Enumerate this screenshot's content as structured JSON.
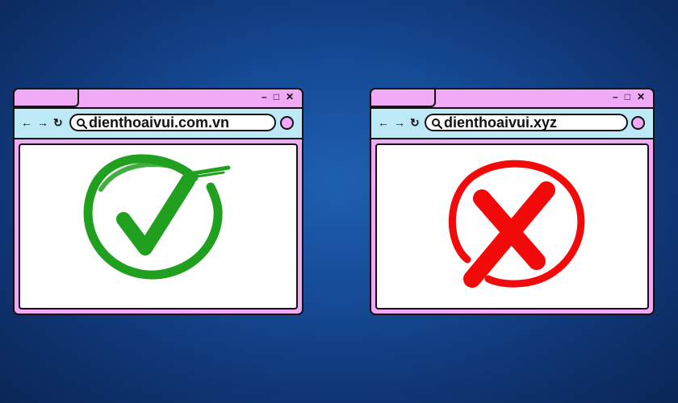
{
  "colors": {
    "background": "#164c98",
    "window_frame": "#efa9f5",
    "toolbar": "#bde8f6",
    "valid_mark": "#21a020",
    "invalid_mark": "#f20a0a"
  },
  "window_controls": {
    "minimize": "–",
    "maximize": "□",
    "close": "✕"
  },
  "nav_icons": {
    "back": "←",
    "forward": "→",
    "reload": "↻"
  },
  "browsers": [
    {
      "url": "dienthoaivui.com.vn",
      "status_icon": "check-icon",
      "status_color": "#21a020"
    },
    {
      "url": "dienthoaivui.xyz",
      "status_icon": "cross-icon",
      "status_color": "#f20a0a"
    }
  ]
}
